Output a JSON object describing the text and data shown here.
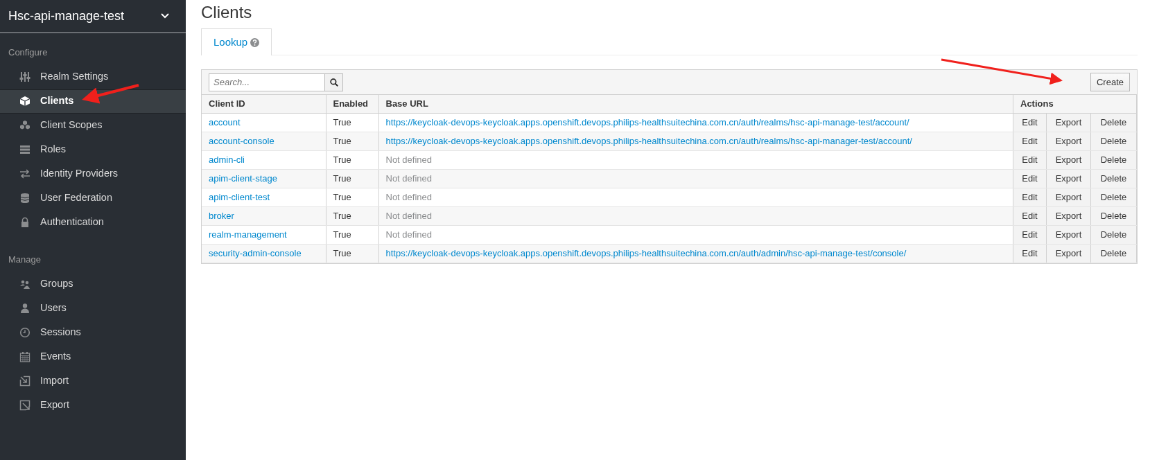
{
  "sidebar": {
    "realm": "Hsc-api-manage-test",
    "sections": [
      {
        "label": "Configure",
        "items": [
          {
            "label": "Realm Settings",
            "selected": false
          },
          {
            "label": "Clients",
            "selected": true
          },
          {
            "label": "Client Scopes",
            "selected": false
          },
          {
            "label": "Roles",
            "selected": false
          },
          {
            "label": "Identity Providers",
            "selected": false
          },
          {
            "label": "User Federation",
            "selected": false
          },
          {
            "label": "Authentication",
            "selected": false
          }
        ]
      },
      {
        "label": "Manage",
        "items": [
          {
            "label": "Groups",
            "selected": false
          },
          {
            "label": "Users",
            "selected": false
          },
          {
            "label": "Sessions",
            "selected": false
          },
          {
            "label": "Events",
            "selected": false
          },
          {
            "label": "Import",
            "selected": false
          },
          {
            "label": "Export",
            "selected": false
          }
        ]
      }
    ]
  },
  "page": {
    "title": "Clients",
    "tabs": [
      {
        "label": "Lookup",
        "selected": true
      }
    ],
    "search": {
      "placeholder": "Search..."
    },
    "create_button": "Create",
    "table": {
      "columns": [
        "Client ID",
        "Enabled",
        "Base URL",
        "Actions"
      ],
      "rows": [
        {
          "client_id": "account",
          "enabled": "True",
          "base_url": "https://keycloak-devops-keycloak.apps.openshift.devops.philips-healthsuitechina.com.cn/auth/realms/hsc-api-manage-test/account/",
          "kind": "link",
          "actions": [
            "Edit",
            "Export",
            "Delete"
          ]
        },
        {
          "client_id": "account-console",
          "enabled": "True",
          "base_url": "https://keycloak-devops-keycloak.apps.openshift.devops.philips-healthsuitechina.com.cn/auth/realms/hsc-api-manager-test/account/",
          "kind": "link",
          "actions": [
            "Edit",
            "Export",
            "Delete"
          ]
        },
        {
          "client_id": "admin-cli",
          "enabled": "True",
          "base_url": "Not defined",
          "kind": "none",
          "actions": [
            "Edit",
            "Export",
            "Delete"
          ]
        },
        {
          "client_id": "apim-client-stage",
          "enabled": "True",
          "base_url": "Not defined",
          "kind": "none",
          "actions": [
            "Edit",
            "Export",
            "Delete"
          ]
        },
        {
          "client_id": "apim-client-test",
          "enabled": "True",
          "base_url": "Not defined",
          "kind": "none",
          "actions": [
            "Edit",
            "Export",
            "Delete"
          ]
        },
        {
          "client_id": "broker",
          "enabled": "True",
          "base_url": "Not defined",
          "kind": "none",
          "actions": [
            "Edit",
            "Export",
            "Delete"
          ]
        },
        {
          "client_id": "realm-management",
          "enabled": "True",
          "base_url": "Not defined",
          "kind": "none",
          "actions": [
            "Edit",
            "Export",
            "Delete"
          ]
        },
        {
          "client_id": "security-admin-console",
          "enabled": "True",
          "base_url": "https://keycloak-devops-keycloak.apps.openshift.devops.philips-healthsuitechina.com.cn/auth/admin/hsc-api-manage-test/console/",
          "kind": "link",
          "actions": [
            "Edit",
            "Export",
            "Delete"
          ]
        }
      ]
    }
  }
}
